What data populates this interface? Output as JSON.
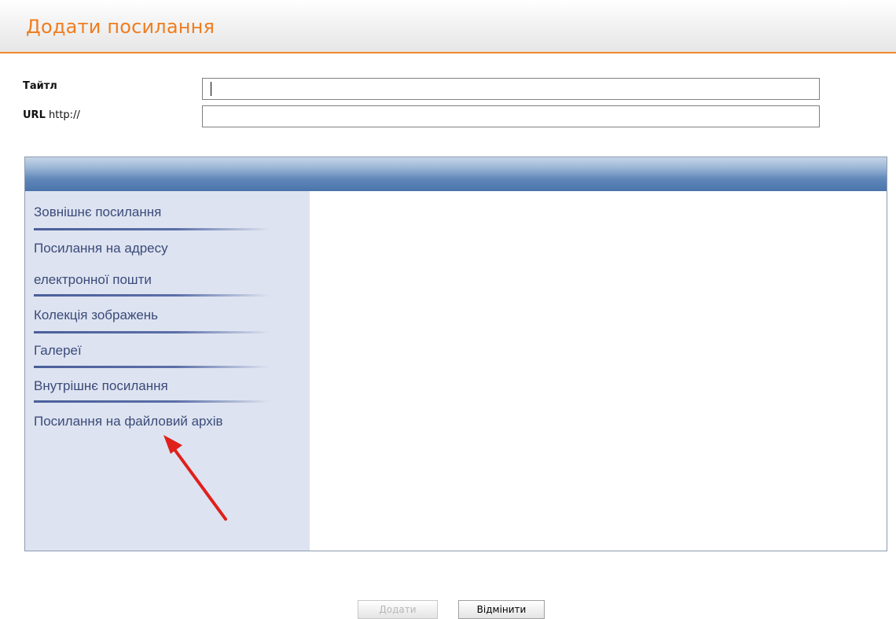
{
  "header": {
    "title": "Додати посилання"
  },
  "form": {
    "title_label": "Тайтл",
    "title_value": "",
    "url_label": "URL",
    "url_prefix": "http://",
    "url_value": ""
  },
  "link_types": [
    {
      "label": "Зовнішнє посилання"
    },
    {
      "label": "Посилання на адресу"
    },
    {
      "label": "електронної пошти"
    },
    {
      "label": "Колекція зображень"
    },
    {
      "label": "Галереї"
    },
    {
      "label": "Внутрішнє посилання"
    },
    {
      "label": "Посилання на файловий архів"
    }
  ],
  "buttons": {
    "add_label": "Додати",
    "cancel_label": "Відмінити"
  },
  "colors": {
    "accent_orange": "#ef7d20",
    "panel_bar_blue": "#4a74aa",
    "sidebar_bg": "#dde3f0",
    "annotation_arrow": "#e0201c"
  },
  "annotation": {
    "arrow_target": "Посилання на файловий архів"
  }
}
